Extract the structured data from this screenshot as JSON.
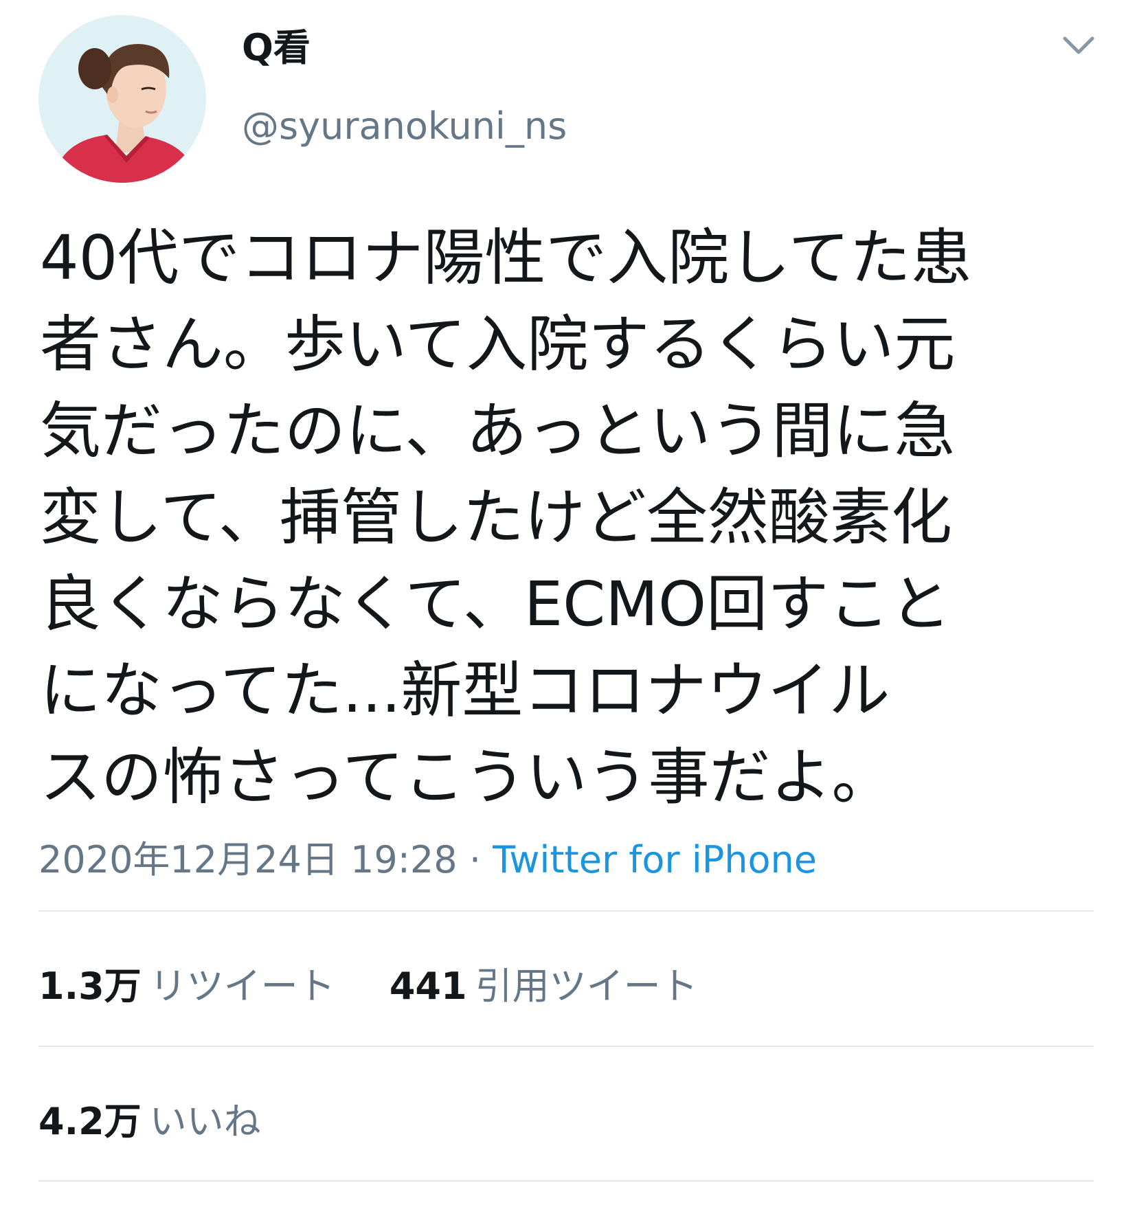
{
  "user": {
    "display_name": "Q看",
    "handle": "@syuranokuni_ns",
    "avatar": "nurse-profile-photo"
  },
  "header": {
    "menu_icon": "chevron-down-icon"
  },
  "tweet": {
    "text": "40代でコロナ陽性で入院してた患\n者さん。歩いて入院するくらい元\n気だったのに、あっという間に急\n変して、挿管したけど全然酸素化\n良くならなくて、ECMO回すこと\nになってた...新型コロナウイル\nスの怖さってこういう事だよ。",
    "timestamp": "2020年12月24日 19:28",
    "separator": "·",
    "source": "Twitter for iPhone"
  },
  "stats": {
    "retweets_count": "1.3万",
    "retweets_label": "リツイート",
    "quotes_count": "441",
    "quotes_label": "引用ツイート",
    "likes_count": "4.2万",
    "likes_label": "いいね"
  },
  "colors": {
    "text_primary": "#14171a",
    "text_secondary": "#657786",
    "link": "#1b95e0",
    "divider": "#e1e8ed",
    "avatar_bg": "#dff1f4",
    "scrubs": "#d8304a"
  }
}
